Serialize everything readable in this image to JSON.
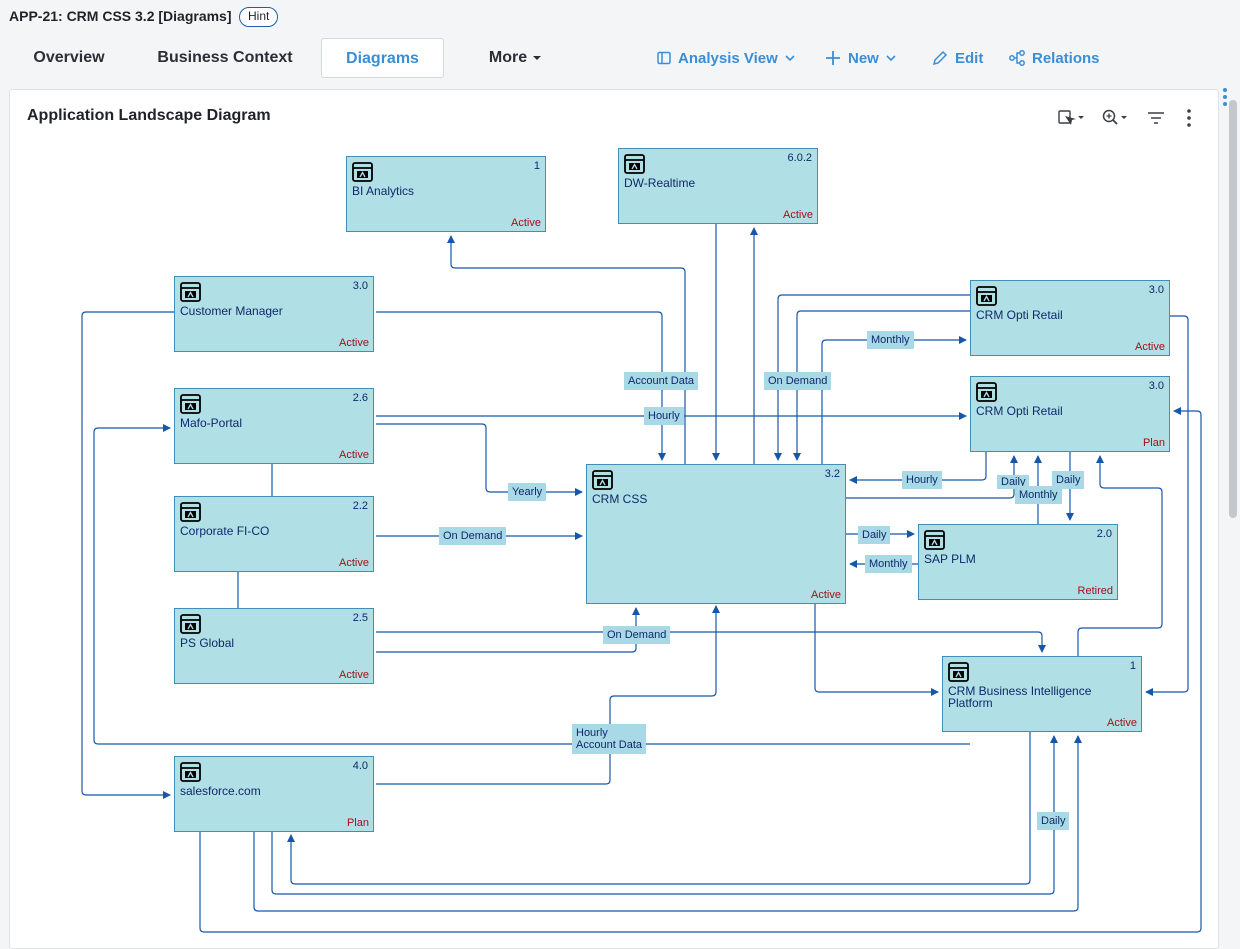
{
  "app": {
    "title": "APP-21: CRM CSS 3.2 [Diagrams]",
    "hint": "Hint"
  },
  "tabs": [
    {
      "label": "Overview"
    },
    {
      "label": "Business Context"
    },
    {
      "label": "Diagrams"
    },
    {
      "label": "More"
    }
  ],
  "actions": {
    "analysis_view": "Analysis View",
    "new": "New",
    "edit": "Edit",
    "relations": "Relations"
  },
  "diagram": {
    "title": "Application Landscape Diagram",
    "nodes": {
      "bi_analytics": {
        "name": "BI Analytics",
        "version": "1",
        "status": "Active"
      },
      "dw_realtime": {
        "name": "DW-Realtime",
        "version": "6.0.2",
        "status": "Active"
      },
      "customer_manager": {
        "name": "Customer Manager",
        "version": "3.0",
        "status": "Active"
      },
      "crm_opti_retail_active": {
        "name": "CRM Opti Retail",
        "version": "3.0",
        "status": "Active"
      },
      "crm_opti_retail_plan": {
        "name": "CRM Opti Retail",
        "version": "3.0",
        "status": "Plan"
      },
      "mafo_portal": {
        "name": "Mafo-Portal",
        "version": "2.6",
        "status": "Active"
      },
      "crm_css": {
        "name": "CRM CSS",
        "version": "3.2",
        "status": "Active"
      },
      "corporate_fico": {
        "name": "Corporate FI-CO",
        "version": "2.2",
        "status": "Active"
      },
      "sap_plm": {
        "name": "SAP PLM",
        "version": "2.0",
        "status": "Retired"
      },
      "ps_global": {
        "name": "PS Global",
        "version": "2.5",
        "status": "Active"
      },
      "crm_bi_platform": {
        "name": "CRM Business Intelligence Platform",
        "version": "1",
        "status": "Active"
      },
      "salesforce": {
        "name": "salesforce.com",
        "version": "4.0",
        "status": "Plan"
      }
    },
    "edge_labels": {
      "account_data": "Account Data",
      "on_demand_top": "On Demand",
      "monthly_top": "Monthly",
      "hourly_mafo": "Hourly",
      "yearly": "Yearly",
      "hourly_right": "Hourly",
      "daily_a": "Daily",
      "monthly_mid": "Monthly",
      "daily_b": "Daily",
      "on_demand_fico": "On Demand",
      "daily_plm": "Daily",
      "monthly_plm": "Monthly",
      "on_demand_ps": "On Demand",
      "hourly_account_1": "Hourly",
      "hourly_account_2": "Account Data",
      "daily_bottom": "Daily"
    }
  }
}
